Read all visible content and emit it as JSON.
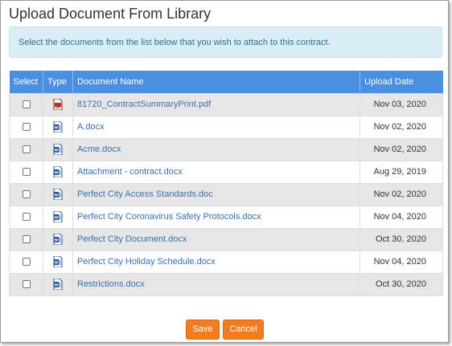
{
  "dialog": {
    "title": "Upload Document From Library",
    "info": "Select the documents from the list below that you wish to attach to this contract."
  },
  "table": {
    "headers": [
      "Select",
      "Type",
      "Document Name",
      "Upload Date"
    ],
    "rows": [
      {
        "type": "pdf-icon",
        "name": "81720_ContractSummaryPrint.pdf",
        "date": "Nov 03, 2020"
      },
      {
        "type": "docx-icon",
        "name": "A.docx",
        "date": "Nov 02, 2020"
      },
      {
        "type": "docx-icon",
        "name": "Acme.docx",
        "date": "Nov 02, 2020"
      },
      {
        "type": "docx-icon",
        "name": "Attachment - contract.docx",
        "date": "Aug 29, 2019"
      },
      {
        "type": "docx-icon",
        "name": "Perfect City Access Standards.doc",
        "date": "Nov 02, 2020"
      },
      {
        "type": "docx-icon",
        "name": "Perfect City Coronavirus Safety Protocols.docx",
        "date": "Nov 04, 2020"
      },
      {
        "type": "docx-icon",
        "name": "Perfect City Document.docx",
        "date": "Oct 30, 2020"
      },
      {
        "type": "docx-icon",
        "name": "Perfect City Holiday Schedule.docx",
        "date": "Nov 04, 2020"
      },
      {
        "type": "docx-icon",
        "name": "Restrictions.docx",
        "date": "Oct 30, 2020"
      }
    ]
  },
  "buttons": {
    "save": "Save",
    "cancel": "Cancel"
  },
  "colors": {
    "header": "#4a8fe0",
    "button": "#f47c20",
    "info_bg": "#d9edf7",
    "link": "#3a6fb0"
  }
}
